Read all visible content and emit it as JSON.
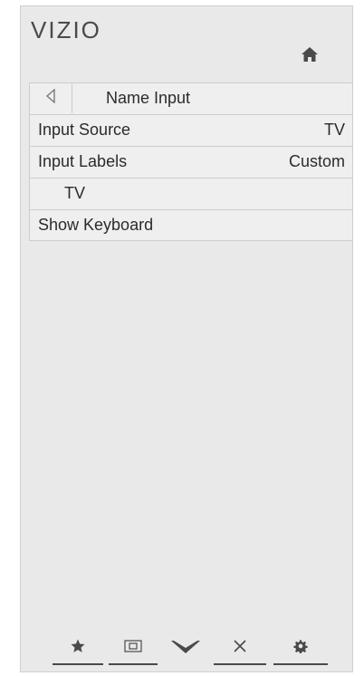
{
  "header": {
    "logo_text": "VIZIO",
    "home_icon": "home-icon"
  },
  "menu": {
    "title": "Name Input",
    "back_icon": "back-arrow-icon",
    "items": [
      {
        "label": "Input Source",
        "value": "TV"
      },
      {
        "label": "Input Labels",
        "value": "Custom"
      },
      {
        "label": "TV",
        "value": ""
      },
      {
        "label": "Show Keyboard",
        "value": ""
      }
    ]
  },
  "bottom_bar": {
    "buttons": [
      {
        "icon": "star-icon"
      },
      {
        "icon": "screen-icon"
      },
      {
        "icon": "vizio-v-icon"
      },
      {
        "icon": "close-icon"
      },
      {
        "icon": "gear-icon"
      }
    ]
  },
  "colors": {
    "panel_bg": "#e9e9e9",
    "row_bg": "#efefef",
    "text": "#2b2b2b",
    "border": "#cdcdcd"
  }
}
